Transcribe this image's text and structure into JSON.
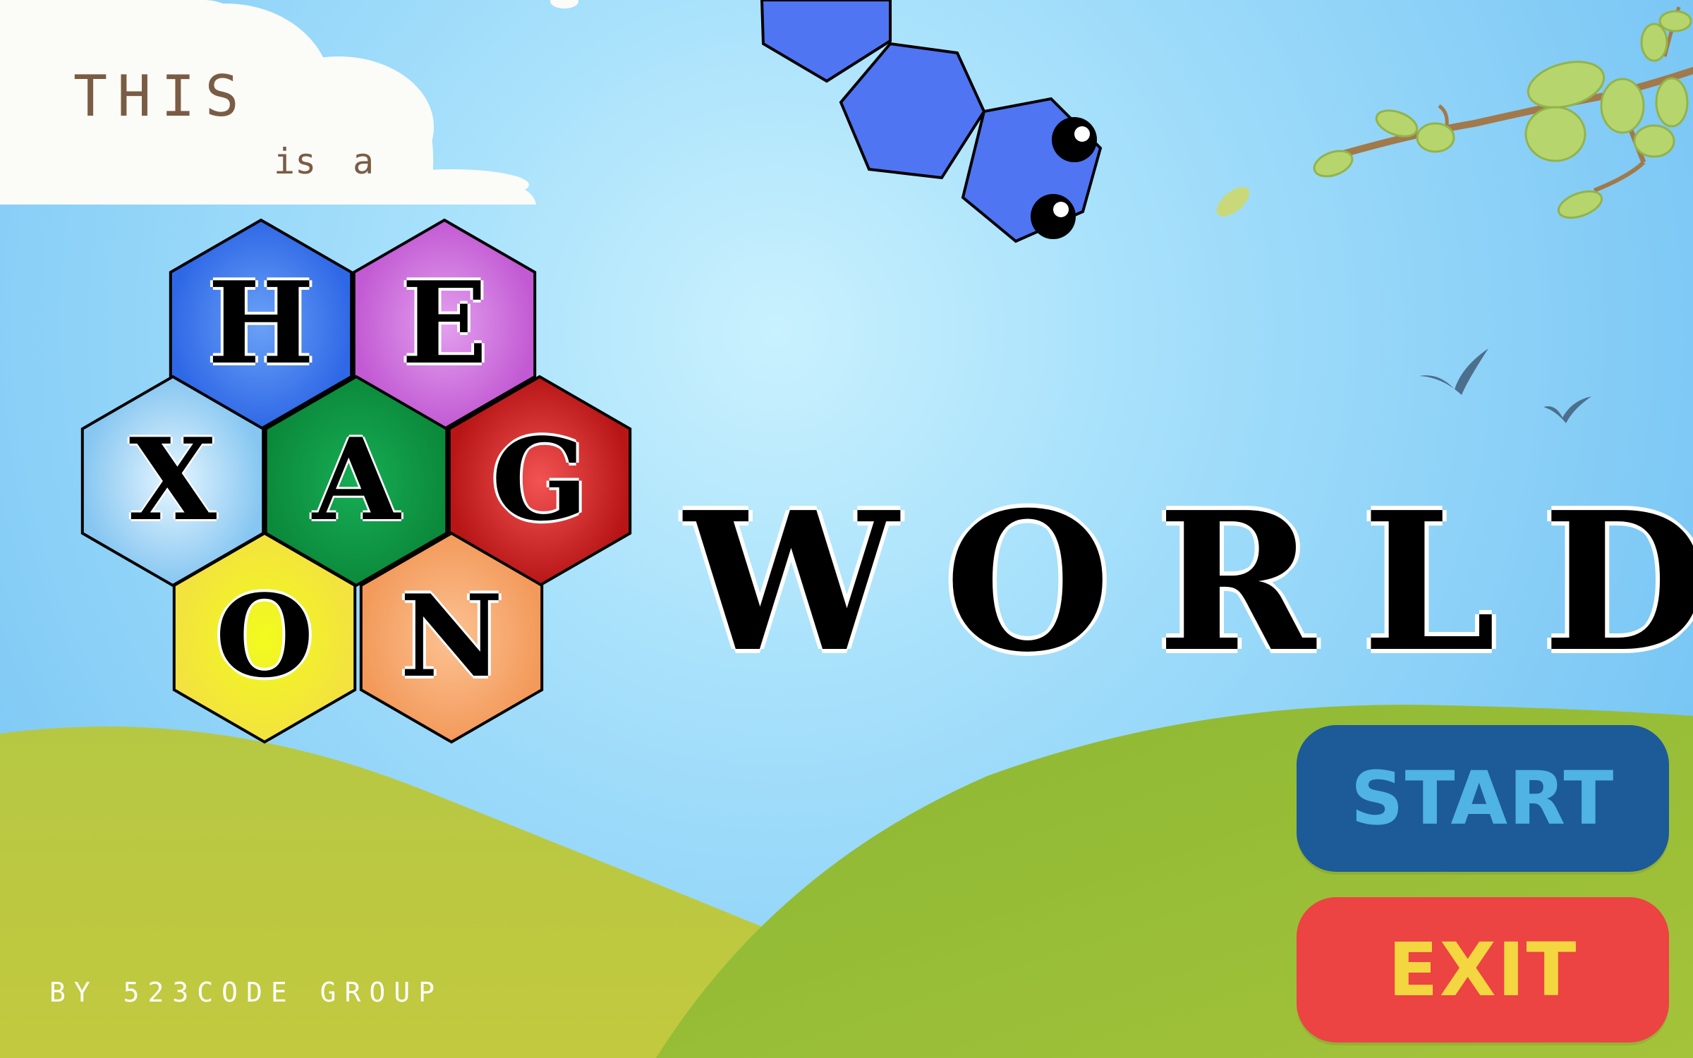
{
  "intro": {
    "line1": "THIS",
    "line2_word1": "is",
    "line2_word2": "a"
  },
  "logo_letters": [
    {
      "letter": "H",
      "color_center": "#6aa2f7",
      "color_edge": "#2f68e6"
    },
    {
      "letter": "E",
      "color_center": "#e3a0ef",
      "color_edge": "#c25ad3"
    },
    {
      "letter": "X",
      "color_center": "#d6f0ff",
      "color_edge": "#8ccaf2"
    },
    {
      "letter": "A",
      "color_center": "#13a550",
      "color_edge": "#0c8a3c"
    },
    {
      "letter": "G",
      "color_center": "#f04a4a",
      "color_edge": "#c01b1b"
    },
    {
      "letter": "O",
      "color_center": "#f4f61c",
      "color_edge": "#f3e63a"
    },
    {
      "letter": "N",
      "color_center": "#fbb785",
      "color_edge": "#f39c5f"
    }
  ],
  "title_word": "WORLD",
  "buttons": {
    "start": "START",
    "exit": "EXIT"
  },
  "credit": "BY 523CODE GROUP",
  "colors": {
    "sky_light": "#c7effd",
    "sky_dark": "#7fcaf6",
    "hill": "#a9c23e",
    "snake": "#4f75f3",
    "start_bg": "#1d5a98",
    "start_text": "#4fb3e3",
    "exit_bg": "#ec4343",
    "exit_text": "#f3d640"
  },
  "icons": [
    "cloud-icon",
    "snake-icon",
    "branch-icon",
    "leaf-icon",
    "bird-icon"
  ]
}
